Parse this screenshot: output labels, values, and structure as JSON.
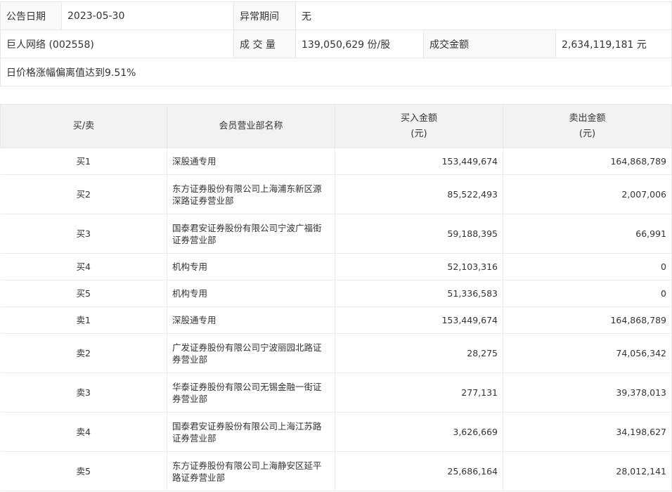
{
  "info": {
    "date_label": "公告日期",
    "date_value": "2023-05-30",
    "period_label": "异常期间",
    "period_value": "无",
    "stock_name": "巨人网络 (002558)",
    "volume_label": "成 交 量",
    "volume_value": "139,050,629 份/股",
    "amount_label": "成交金额",
    "amount_value": "2,634,119,181 元",
    "reason": "日价格涨幅偏离值达到9.51%"
  },
  "table": {
    "headers": {
      "side": "买/卖",
      "dept": "会员营业部名称",
      "buy_line1": "买入金额",
      "buy_line2": "(元)",
      "sell_line1": "卖出金额",
      "sell_line2": "(元)"
    },
    "rows": [
      {
        "side": "买1",
        "dept": "深股通专用",
        "buy": "153,449,674",
        "sell": "164,868,789"
      },
      {
        "side": "买2",
        "dept": "东方证券股份有限公司上海浦东新区源深路证券营业部",
        "buy": "85,522,493",
        "sell": "2,007,006"
      },
      {
        "side": "买3",
        "dept": "国泰君安证券股份有限公司宁波广福街证券营业部",
        "buy": "59,188,395",
        "sell": "66,991"
      },
      {
        "side": "买4",
        "dept": "机构专用",
        "buy": "52,103,316",
        "sell": "0"
      },
      {
        "side": "买5",
        "dept": "机构专用",
        "buy": "51,336,583",
        "sell": "0"
      },
      {
        "side": "卖1",
        "dept": "深股通专用",
        "buy": "153,449,674",
        "sell": "164,868,789"
      },
      {
        "side": "卖2",
        "dept": "广发证券股份有限公司宁波丽园北路证券营业部",
        "buy": "28,275",
        "sell": "74,056,342"
      },
      {
        "side": "卖3",
        "dept": "华泰证券股份有限公司无锡金融一街证券营业部",
        "buy": "277,131",
        "sell": "39,378,013"
      },
      {
        "side": "卖4",
        "dept": "国泰君安证券股份有限公司上海江苏路证券营业部",
        "buy": "3,626,669",
        "sell": "34,198,627"
      },
      {
        "side": "卖5",
        "dept": "东方证券股份有限公司上海静安区延平路证券营业部",
        "buy": "25,686,164",
        "sell": "28,012,141"
      }
    ]
  }
}
